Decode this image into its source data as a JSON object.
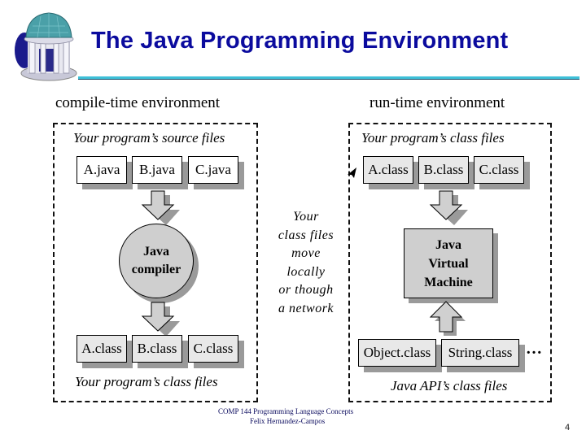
{
  "slide": {
    "title": "The Java Programming Environment",
    "logo": "old-well-icon",
    "page_number": "4",
    "footer": {
      "line1": "COMP 144 Programming Language Concepts",
      "line2": "Felix Hernandez-Campos"
    }
  },
  "compile_time": {
    "heading": "compile-time environment",
    "source_caption": "Your program’s source files",
    "source_files": [
      "A.java",
      "B.java",
      "C.java"
    ],
    "compiler_lines": [
      "Java",
      "compiler"
    ],
    "output_files": [
      "A.class",
      "B.class",
      "C.class"
    ],
    "output_caption": "Your program’s class files"
  },
  "transfer_note": [
    "Your",
    "class files",
    "move",
    "locally",
    "or though",
    "a network"
  ],
  "run_time": {
    "heading": "run-time environment",
    "class_caption": "Your program’s class files",
    "class_files": [
      "A.class",
      "B.class",
      "C.class"
    ],
    "jvm_lines": [
      "Java",
      "Virtual",
      "Machine"
    ],
    "api_files": [
      "Object.class",
      "String.class"
    ],
    "api_more": "…",
    "api_caption": "Java API’s class files"
  }
}
